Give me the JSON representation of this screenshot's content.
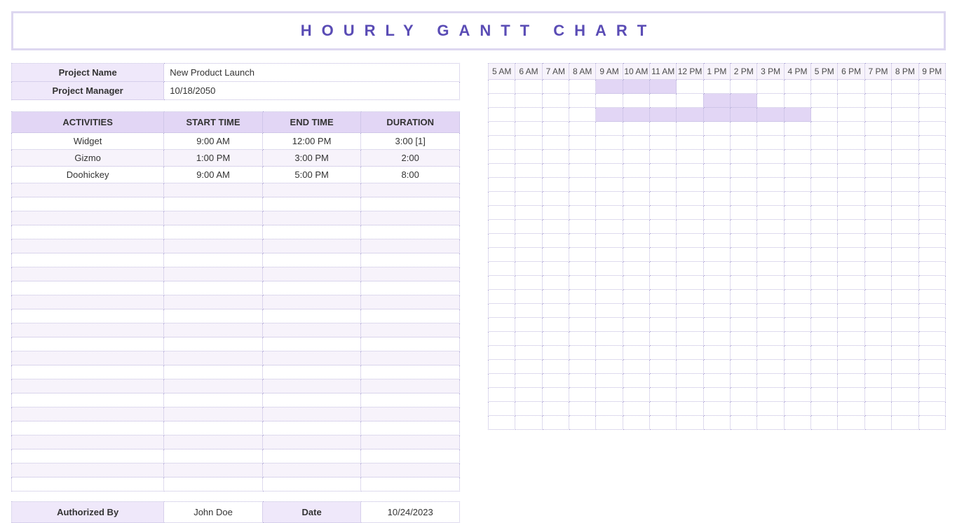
{
  "title": "HOURLY GANTT CHART",
  "meta": {
    "project_name_label": "Project Name",
    "project_name_value": "New Product Launch",
    "project_manager_label": "Project Manager",
    "project_manager_value": "10/18/2050"
  },
  "act_headers": {
    "activities": "ACTIVITIES",
    "start": "START TIME",
    "end": "END TIME",
    "duration": "DURATION"
  },
  "activities": [
    {
      "name": "Widget",
      "start": "9:00 AM",
      "end": "12:00 PM",
      "duration": "3:00 [1]"
    },
    {
      "name": "Gizmo",
      "start": "1:00 PM",
      "end": "3:00 PM",
      "duration": "2:00"
    },
    {
      "name": "Doohickey",
      "start": "9:00 AM",
      "end": "5:00 PM",
      "duration": "8:00"
    }
  ],
  "hours": [
    "5 AM",
    "6 AM",
    "7 AM",
    "8 AM",
    "9 AM",
    "10 AM",
    "11 AM",
    "12 PM",
    "1 PM",
    "2 PM",
    "3 PM",
    "4 PM",
    "5 PM",
    "6 PM",
    "7 PM",
    "8 PM",
    "9 PM"
  ],
  "signature": {
    "auth_label": "Authorized By",
    "auth_value": "John Doe",
    "date_label": "Date",
    "date_value": "10/24/2023"
  },
  "chart_data": {
    "type": "bar",
    "orientation": "horizontal-gantt",
    "title": "Hourly Gantt Chart",
    "x_categories_hours": [
      "5 AM",
      "6 AM",
      "7 AM",
      "8 AM",
      "9 AM",
      "10 AM",
      "11 AM",
      "12 PM",
      "1 PM",
      "2 PM",
      "3 PM",
      "4 PM",
      "5 PM",
      "6 PM",
      "7 PM",
      "8 PM",
      "9 PM"
    ],
    "series": [
      {
        "name": "Widget",
        "start_hour": 9,
        "end_hour": 12,
        "duration_hours": 3
      },
      {
        "name": "Gizmo",
        "start_hour": 13,
        "end_hour": 15,
        "duration_hours": 2
      },
      {
        "name": "Doohickey",
        "start_hour": 9,
        "end_hour": 17,
        "duration_hours": 8
      }
    ],
    "empty_rows": 22,
    "grid_start_hour": 5,
    "grid_end_hour": 21
  }
}
